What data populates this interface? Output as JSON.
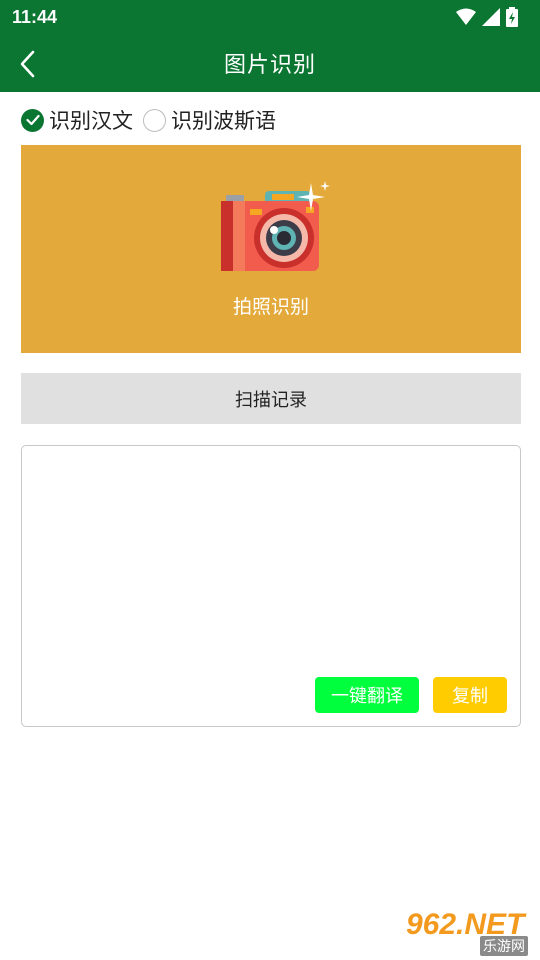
{
  "status_bar": {
    "time": "11:44",
    "icons": [
      "wifi-icon",
      "signal-icon",
      "battery-icon"
    ]
  },
  "toolbar": {
    "title": "图片识别",
    "back_icon": "chevron-left-icon"
  },
  "language_options": [
    {
      "label": "识别汉文",
      "checked": true
    },
    {
      "label": "识别波斯语",
      "checked": false
    }
  ],
  "photo_panel": {
    "label": "拍照识别",
    "icon": "camera-icon",
    "bg_color": "#e3aa3b"
  },
  "history_button": {
    "label": "扫描记录"
  },
  "result": {
    "text": "",
    "translate_label": "一键翻译",
    "copy_label": "复制"
  },
  "watermark": {
    "logo": "962.NET",
    "sub": "乐游网"
  },
  "colors": {
    "primary": "#0a7631",
    "translate": "#00ff3c",
    "copy": "#ffcc00",
    "history_bg": "#e0e0e0"
  }
}
